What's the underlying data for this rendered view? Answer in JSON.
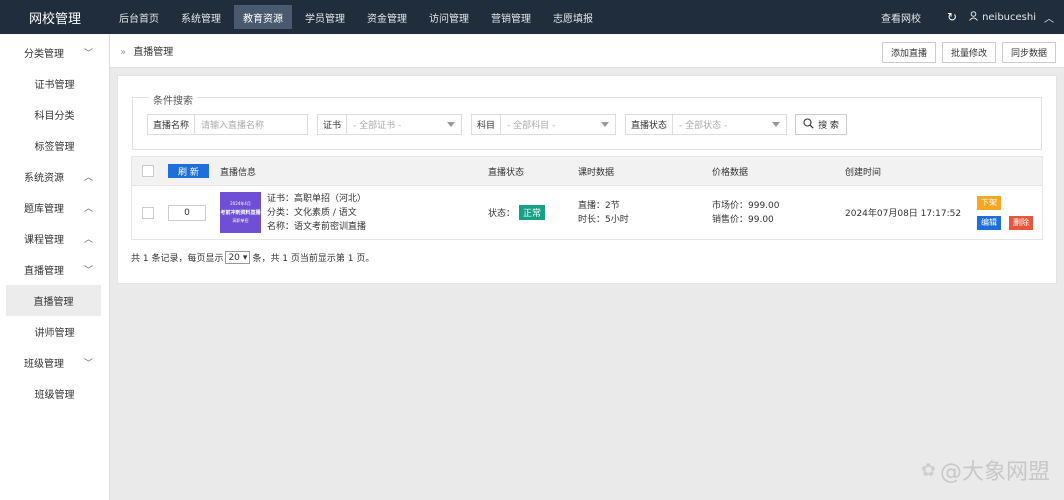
{
  "brand": "网校管理",
  "nav": [
    {
      "label": "后台首页",
      "active": false
    },
    {
      "label": "系统管理",
      "active": false
    },
    {
      "label": "教育资源",
      "active": true
    },
    {
      "label": "学员管理",
      "active": false
    },
    {
      "label": "资金管理",
      "active": false
    },
    {
      "label": "访问管理",
      "active": false
    },
    {
      "label": "营销管理",
      "active": false
    },
    {
      "label": "志愿填报",
      "active": false
    }
  ],
  "topright": {
    "view_site": "查看网校",
    "user": "neibuceshi"
  },
  "sidebar": {
    "g1": "分类管理",
    "g1_items": [
      "证书管理",
      "科目分类",
      "标签管理"
    ],
    "g2": "系统资源",
    "g3": "题库管理",
    "g4": "课程管理",
    "g5": "直播管理",
    "g5_items": [
      "直播管理",
      "讲师管理"
    ],
    "g6": "班级管理",
    "g6_items": [
      "班级管理"
    ]
  },
  "breadcrumb": {
    "sep": "»",
    "current": "直播管理"
  },
  "actions": {
    "add": "添加直播",
    "batch": "批量修改",
    "sync": "同步数据"
  },
  "filter": {
    "legend": "条件搜索",
    "name_label": "直播名称",
    "name_placeholder": "请输入直播名称",
    "cert_label": "证书",
    "cert_value": "- 全部证书 -",
    "subject_label": "科目",
    "subject_value": "- 全部科目 -",
    "status_label": "直播状态",
    "status_value": "- 全部状态 -",
    "search": "搜 索"
  },
  "table": {
    "refresh": "刷 新",
    "headers": {
      "info": "直播信息",
      "status": "直播状态",
      "lessons": "课时数据",
      "price": "价格数据",
      "created": "创建时间"
    },
    "row": {
      "sort": "0",
      "thumb_l1": "2024年4月",
      "thumb_l2": "考前冲刺资料直播",
      "thumb_l3": "高职单招",
      "cert": "证书：高职单招（河北）",
      "category": "分类：文化素质 / 语文",
      "name": "名称：语文考前密训直播",
      "status_label": "状态：",
      "status_badge": "正常",
      "lessons_live": "直播：2节",
      "lessons_time": "时长：5小时",
      "price_market": "市场价：999.00",
      "price_sale": "销售价：99.00",
      "created": "2024年07月08日 17:17:52",
      "op_off": "下架",
      "op_edit": "编辑",
      "op_delete": "删除"
    }
  },
  "pager": {
    "prefix": "共 1 条记录，每页显示",
    "size": "20",
    "suffix": "条，共 1 页当前显示第 1 页。"
  },
  "watermark": "@大象网盟",
  "colors": {
    "nav_bg": "#1f2d3d",
    "primary": "#1e6fd9",
    "success": "#16a085",
    "warning": "#f5a623",
    "danger": "#e8573c"
  }
}
